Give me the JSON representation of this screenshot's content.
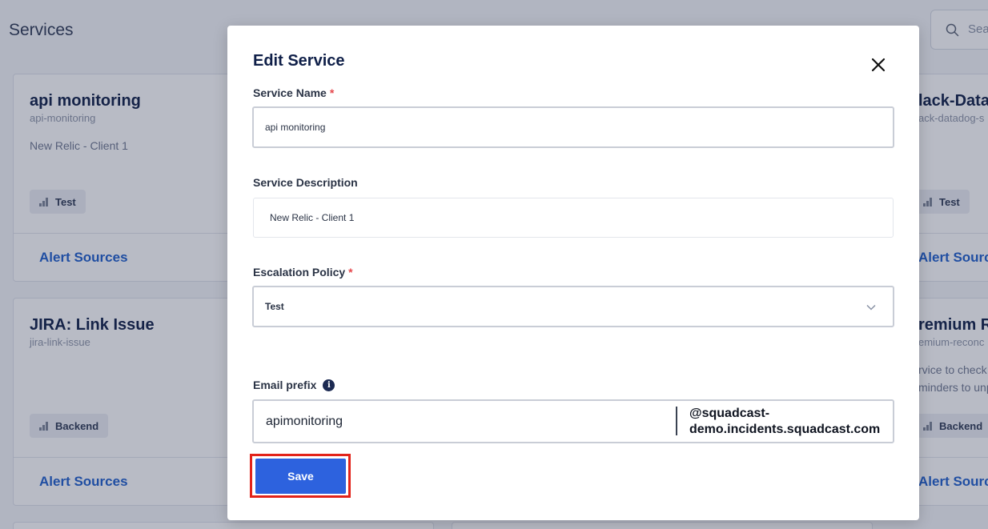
{
  "page": {
    "title": "Services"
  },
  "search": {
    "placeholder": "Search"
  },
  "cards": [
    {
      "name": "api monitoring",
      "slug": "api-monitoring",
      "description": "New Relic - Client 1",
      "tag": "Test",
      "link": "Alert Sources"
    },
    {
      "name": "JIRA: Link Issue",
      "slug": "jira-link-issue",
      "tag": "Backend",
      "link": "Alert Sources"
    },
    {
      "name": "lack-Data",
      "slug": "ack-datadog-s",
      "tag": "Test",
      "link": "Alert Sourc"
    },
    {
      "name": "remium R",
      "slug": "emium-reconc",
      "description_line1": "rvice to check",
      "description_line2": "minders to unp",
      "tag": "Backend",
      "link": "Alert Sourc"
    }
  ],
  "modal": {
    "title": "Edit Service",
    "service_name_label": "Service Name",
    "service_name_value": "api monitoring",
    "required_mark": "*",
    "description_label": "Service Description",
    "description_value": "New Relic - Client 1",
    "escalation_label": "Escalation Policy",
    "escalation_value": "Test",
    "email_label": "Email prefix",
    "email_value": "apimonitoring",
    "email_domain": "@squadcast-\ndemo.incidents.squadcast.com",
    "save_label": "Save"
  },
  "colors": {
    "accent": "#2d62de",
    "link": "#1f5fcc",
    "highlight": "#e2231a",
    "required": "#e5484d"
  }
}
